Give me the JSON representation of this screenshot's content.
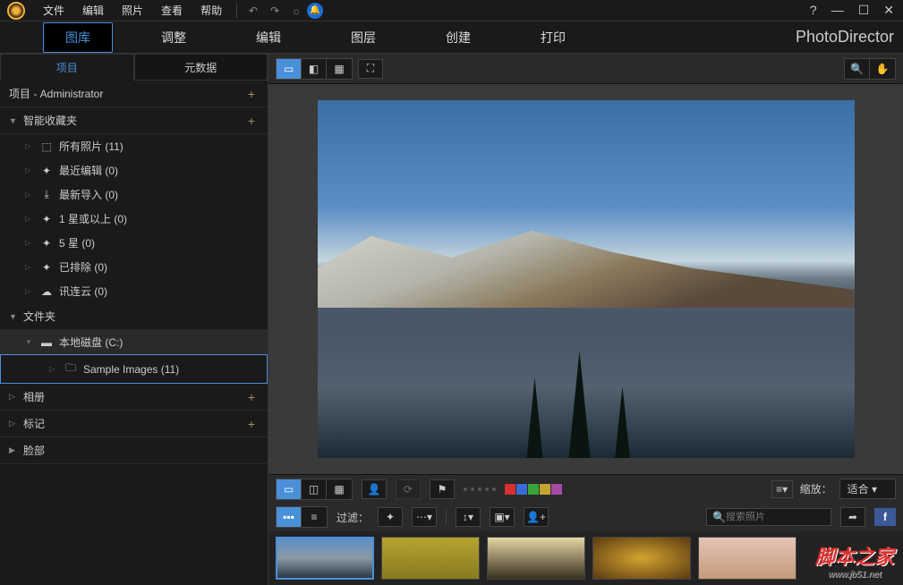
{
  "menubar": {
    "items": [
      "文件",
      "编辑",
      "照片",
      "查看",
      "帮助"
    ]
  },
  "app_name": "PhotoDirector",
  "maintabs": [
    "图库",
    "调整",
    "编辑",
    "图层",
    "创建",
    "打印"
  ],
  "sidebar": {
    "tabs": [
      "项目",
      "元数据"
    ],
    "project_header": "项目 - Administrator",
    "sections": {
      "smart": {
        "label": "智能收藏夹",
        "items": [
          {
            "label": "所有照片 (11)",
            "icon": "hierarchy"
          },
          {
            "label": "最近编辑 (0)",
            "icon": "wand"
          },
          {
            "label": "最新导入 (0)",
            "icon": "import"
          },
          {
            "label": "1 星或以上 (0)",
            "icon": "wand"
          },
          {
            "label": "5 星 (0)",
            "icon": "wand"
          },
          {
            "label": "已排除 (0)",
            "icon": "wand"
          },
          {
            "label": "讯连云 (0)",
            "icon": "cloud"
          }
        ]
      },
      "folders": {
        "label": "文件夹",
        "drive": "本地磁盘 (C:)",
        "folder": "Sample Images (11)"
      },
      "albums": {
        "label": "相册"
      },
      "tags": {
        "label": "标记"
      },
      "faces": {
        "label": "脸部"
      }
    }
  },
  "bottom": {
    "zoom_label": "缩放：",
    "zoom_value": "适合",
    "filter_label": "过滤：",
    "search_placeholder": "搜索照片",
    "colors": [
      "#d43030",
      "#3a6ad4",
      "#3aa43a",
      "#c4a430",
      "#a44aa4"
    ]
  },
  "watermark": {
    "ch": "脚本之家",
    "en": "www.jb51.net"
  }
}
